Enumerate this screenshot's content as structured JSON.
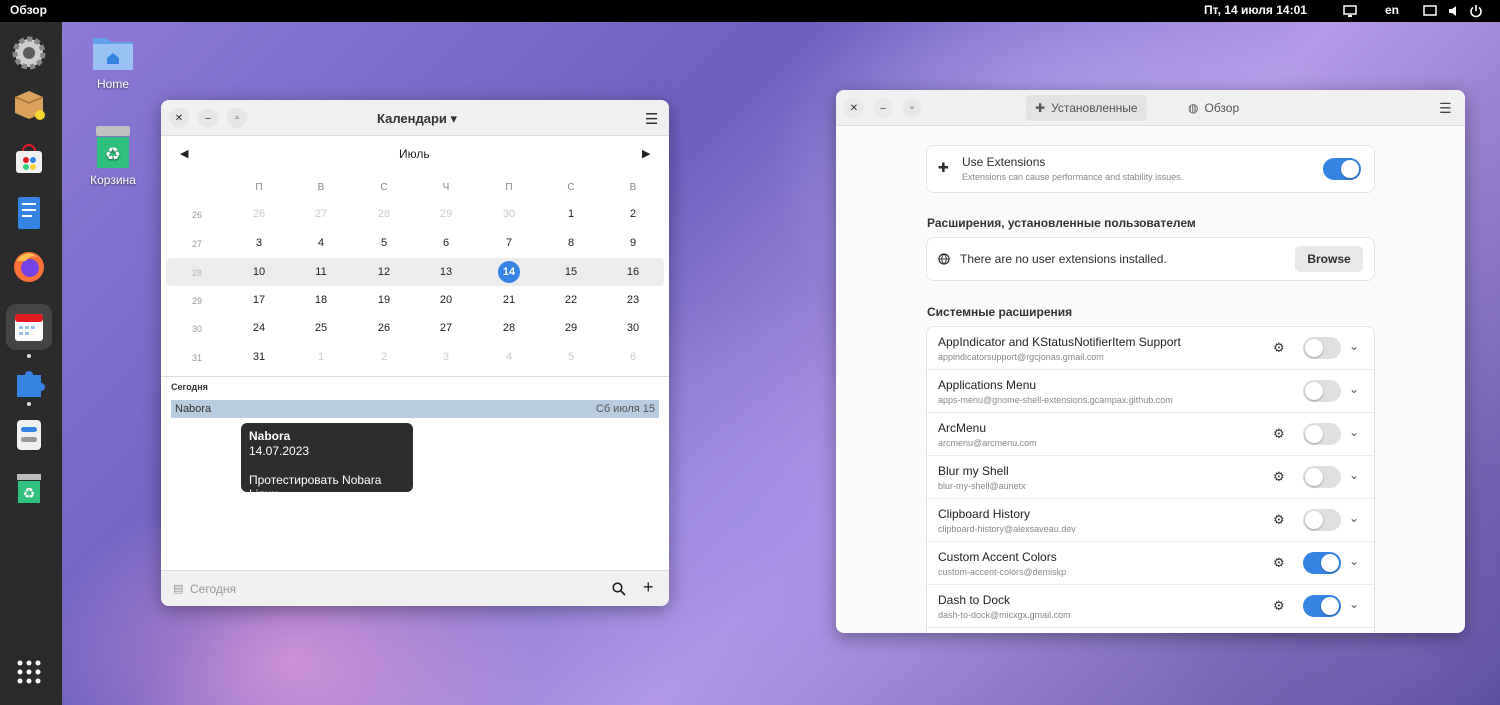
{
  "topbar": {
    "activities": "Обзор",
    "clock": "Пт, 14 июля  14:01",
    "lang": "en"
  },
  "desktop_icons": {
    "home": "Home",
    "trash": "Корзина"
  },
  "calendar": {
    "title": "Календари",
    "month": "Июль",
    "weekdays": [
      "П",
      "В",
      "С",
      "Ч",
      "П",
      "С",
      "В"
    ],
    "weeks": [
      {
        "wk": "26",
        "days": [
          "26",
          "27",
          "28",
          "29",
          "30",
          "1",
          "2"
        ]
      },
      {
        "wk": "27",
        "days": [
          "3",
          "4",
          "5",
          "6",
          "7",
          "8",
          "9"
        ]
      },
      {
        "wk": "28",
        "days": [
          "10",
          "11",
          "12",
          "13",
          "14",
          "15",
          "16"
        ]
      },
      {
        "wk": "29",
        "days": [
          "17",
          "18",
          "19",
          "20",
          "21",
          "22",
          "23"
        ]
      },
      {
        "wk": "30",
        "days": [
          "24",
          "25",
          "26",
          "27",
          "28",
          "29",
          "30"
        ]
      },
      {
        "wk": "31",
        "days": [
          "31",
          "1",
          "2",
          "3",
          "4",
          "5",
          "6"
        ]
      }
    ],
    "today_label": "Сегодня",
    "event": {
      "name": "Nabora",
      "date": "Сб июля 15"
    },
    "tooltip": {
      "title": "Nabora",
      "date": "14.07.2023",
      "desc": "Протестировать Nobara Linux"
    },
    "footer_today": "Сегодня"
  },
  "extensions": {
    "tab_installed": "Установленные",
    "tab_browse": "Обзор",
    "use_extensions": {
      "title": "Use Extensions",
      "subtitle": "Extensions can cause performance and stability issues.",
      "enabled": true
    },
    "user_section_title": "Расширения, установленные пользователем",
    "no_user_ext": "There are no user extensions installed.",
    "browse_button": "Browse",
    "system_section_title": "Системные расширения",
    "items": [
      {
        "name": "AppIndicator and KStatusNotifierItem Support",
        "id": "appindicatorsupport@rgcjonas.gmail.com",
        "settings": true,
        "enabled": false
      },
      {
        "name": "Applications Menu",
        "id": "apps-menu@gnome-shell-extensions.gcampax.github.com",
        "settings": false,
        "enabled": false
      },
      {
        "name": "ArcMenu",
        "id": "arcmenu@arcmenu.com",
        "settings": true,
        "enabled": false
      },
      {
        "name": "Blur my Shell",
        "id": "blur-my-shell@aunetx",
        "settings": true,
        "enabled": false
      },
      {
        "name": "Clipboard History",
        "id": "clipboard-history@alexsaveau.dev",
        "settings": true,
        "enabled": false
      },
      {
        "name": "Custom Accent Colors",
        "id": "custom-accent-colors@demiskp",
        "settings": true,
        "enabled": true
      },
      {
        "name": "Dash to Dock",
        "id": "dash-to-dock@micxgx.gmail.com",
        "settings": true,
        "enabled": true
      }
    ]
  }
}
